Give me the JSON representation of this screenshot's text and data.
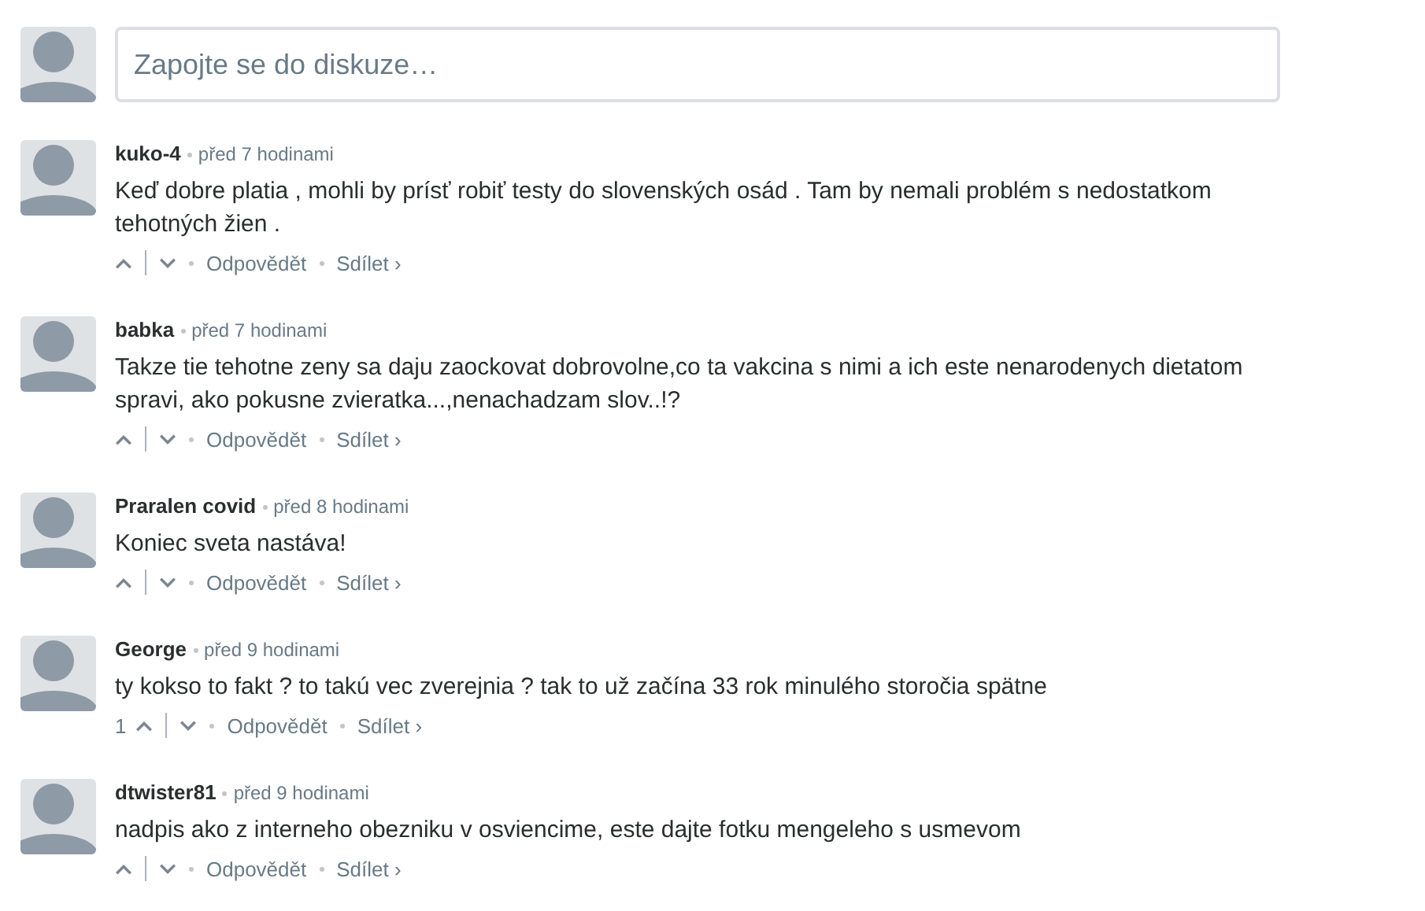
{
  "composer": {
    "placeholder": "Zapojte se do diskuze…"
  },
  "comments": [
    {
      "author": "kuko-4",
      "time": "před 7 hodinami",
      "text": "Keď dobre platia , mohli by prísť robiť testy do slovenských osád . Tam by nemali problém s nedostatkom tehotných žien .",
      "reply": "Odpovědět",
      "share": "Sdílet ›"
    },
    {
      "author": "babka",
      "time": "před 7 hodinami",
      "text": "Takze tie tehotne zeny sa daju zaockovat dobrovolne,co ta vakcina s nimi a ich este nenarodenych dietatom spravi, ako pokusne zvieratka...,nenachadzam slov..!?",
      "reply": "Odpovědět",
      "share": "Sdílet ›"
    },
    {
      "author": "Praralen covid",
      "time": "před 8 hodinami",
      "text": "Koniec sveta nastáva!",
      "reply": "Odpovědět",
      "share": "Sdílet ›"
    },
    {
      "author": "George",
      "time": "před 9 hodinami",
      "text": "ty kokso to fakt ? to takú vec zverejnia ? tak to už začína 33 rok minulého storočia spätne",
      "votes": "1",
      "reply": "Odpovědět",
      "share": "Sdílet ›"
    },
    {
      "author": "dtwister81",
      "time": "před 9 hodinami",
      "text": "nadpis ako z interneho obezniku v osviencime, este dajte fotku mengeleho s usmevom",
      "reply": "Odpovědět",
      "share": "Sdílet ›"
    }
  ]
}
